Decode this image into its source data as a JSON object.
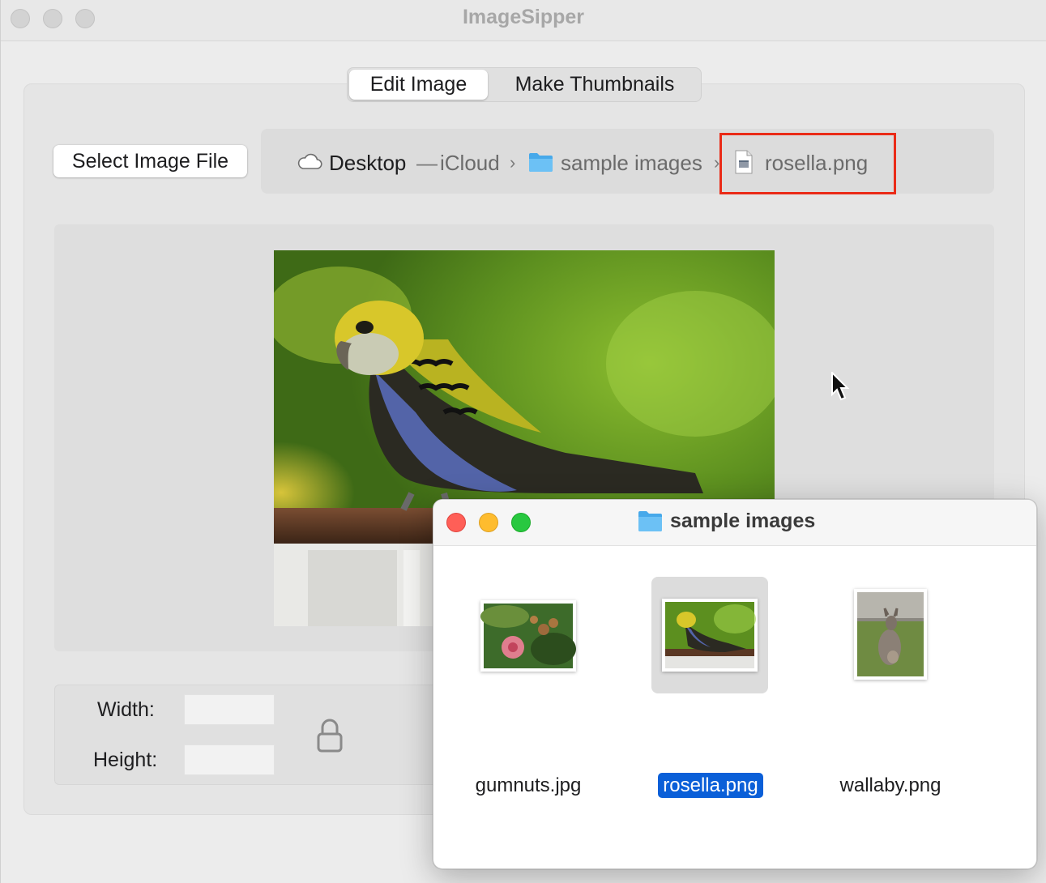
{
  "window": {
    "title": "ImageSipper"
  },
  "tabs": [
    {
      "label": "Edit Image",
      "selected": true
    },
    {
      "label": "Make Thumbnails",
      "selected": false
    }
  ],
  "select_button": {
    "label": "Select Image File"
  },
  "path": {
    "root": "Desktop",
    "separator": "—",
    "location": "iCloud",
    "chevron": "›",
    "folder": "sample images",
    "file": "rosella.png"
  },
  "size_panel": {
    "width_label": "Width:",
    "height_label": "Height:",
    "width_value": "",
    "height_value": ""
  },
  "finder": {
    "title": "sample images",
    "files": [
      {
        "name": "gumnuts.jpg",
        "selected": false
      },
      {
        "name": "rosella.png",
        "selected": true
      },
      {
        "name": "wallaby.png",
        "selected": false
      }
    ]
  },
  "colors": {
    "highlight_box": "#ea2b17",
    "selection_blue": "#0a5fd8",
    "close": "#ff5f57",
    "minimize": "#febc2e",
    "zoom": "#28c840"
  },
  "icons": {
    "cloud": "cloud-icon",
    "folder": "folder-icon",
    "file": "png-file-icon",
    "lock": "lock-icon",
    "cursor": "arrow-cursor-icon"
  }
}
